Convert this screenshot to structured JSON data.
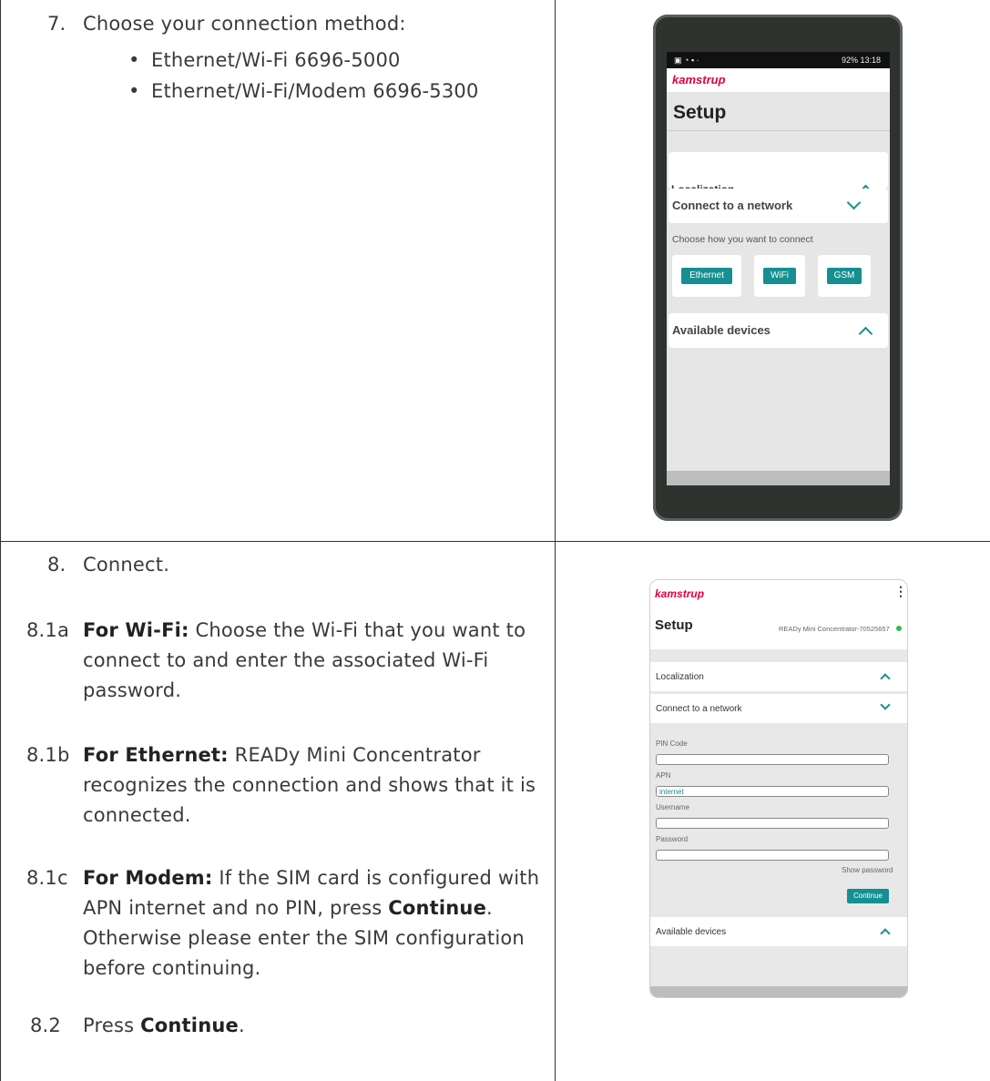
{
  "step7": {
    "num": "7.",
    "text": "Choose your connection method:",
    "bullets": [
      "Ethernet/Wi-Fi 6696-5000",
      "Ethernet/Wi-Fi/Modem 6696-5300"
    ]
  },
  "phone1": {
    "status_right": "92% 13:18",
    "brand": "kamstrup",
    "setup": "Setup",
    "loc_partial": "Localization",
    "connect": "Connect to a network",
    "choose": "Choose how you want to connect",
    "buttons": [
      "Ethernet",
      "WiFi",
      "GSM"
    ],
    "available": "Available devices"
  },
  "step8": {
    "num": "8.",
    "text": "Connect.",
    "a_num": "8.1a",
    "a_bold": "For Wi-Fi:",
    "a_l1": "Choose the Wi-Fi that you want to",
    "a_l2": "connect to and enter the associated Wi-Fi",
    "a_l3": "password.",
    "b_num": "8.1b",
    "b_bold": "For Ethernet:",
    "b_l1": "READy Mini Concentrator",
    "b_l2": "recognizes the connection and shows that it is",
    "b_l3": "connected.",
    "c_num": "8.1c",
    "c_bold": "For Modem:",
    "c_l1": "If the SIM card is configured with",
    "c_l2a": "APN internet and no PIN, press",
    "c_l2b": "Continue",
    "c_l3": "Otherwise please enter the SIM configuration",
    "c_l4": "before continuing.",
    "d_num": "8.2",
    "d_a": "Press",
    "d_b": "Continue"
  },
  "phone2": {
    "brand": "kamstrup",
    "setup": "Setup",
    "device": "READy Mini Concentrator-70525657",
    "localization": "Localization",
    "connect": "Connect to a network",
    "pin": "PIN Code",
    "apn": "APN",
    "apn_value": "internet",
    "username": "Username",
    "password": "Password",
    "show_password": "Show password",
    "continue": "Continue",
    "available": "Available devices"
  }
}
